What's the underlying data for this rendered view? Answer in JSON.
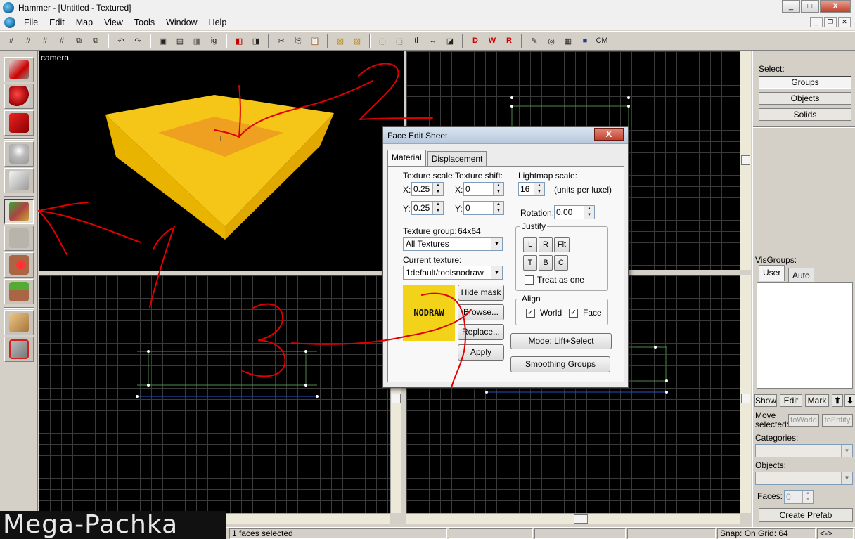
{
  "window": {
    "title": "Hammer - [Untitled - Textured]",
    "controls": [
      "_",
      "□",
      "X"
    ]
  },
  "menu": {
    "items": [
      "File",
      "Edit",
      "Map",
      "View",
      "Tools",
      "Window",
      "Help"
    ]
  },
  "toolbar": {
    "text_items": [
      "ig",
      "tl",
      "CM"
    ]
  },
  "viewports": {
    "camera_label": "camera"
  },
  "dialog": {
    "title": "Face Edit Sheet",
    "close": "X",
    "tabs": [
      "Material",
      "Displacement"
    ],
    "texture_scale_label": "Texture scale:",
    "texture_shift_label": "Texture shift:",
    "lightmap_scale_label": "Lightmap scale:",
    "x_label": "X:",
    "y_label": "Y:",
    "scale_x": "0.25",
    "scale_y": "0.25",
    "shift_x": "0",
    "shift_y": "0",
    "lightmap_scale": "16",
    "units_note": "(units per luxel)",
    "rotation_label": "Rotation:",
    "rotation": "0.00",
    "justify_label": "Justify",
    "justify_buttons": [
      "L",
      "R",
      "Fit",
      "T",
      "B",
      "C"
    ],
    "treat_as_one": "Treat as one",
    "texture_group_label": "Texture group:",
    "texture_group_size": "64x64",
    "texture_group_value": "All Textures",
    "current_texture_label": "Current texture:",
    "current_texture_value": "1default/toolsnodraw",
    "preview_text": "NODRAW",
    "hide_mask": "Hide mask",
    "browse": "Browse...",
    "replace": "Replace...",
    "apply": "Apply",
    "align_label": "Align",
    "align_world": "World",
    "align_face": "Face",
    "mode_button": "Mode: Lift+Select",
    "smoothing_button": "Smoothing Groups"
  },
  "right_panel": {
    "select_label": "Select:",
    "select_buttons": [
      "Groups",
      "Objects",
      "Solids"
    ],
    "visgroups_label": "VisGroups:",
    "visgroup_tabs": [
      "User",
      "Auto"
    ],
    "vis_buttons": [
      "Show",
      "Edit",
      "Mark"
    ],
    "move_selected_label": "Move selected:",
    "to_world": "toWorld",
    "to_entity": "toEntity",
    "categories_label": "Categories:",
    "objects_label": "Objects:",
    "faces_label": "Faces:",
    "faces_value": "0",
    "create_prefab": "Create Prefab"
  },
  "status": {
    "selection": "1 faces selected",
    "snap": "Snap: On Grid: 64",
    "arrows": "<->"
  },
  "watermark": "Mega-Pachka",
  "annotations": [
    "1",
    "2",
    "3"
  ],
  "colors": {
    "brush_top": "#f5c518",
    "brush_side": "#e8a800",
    "selected_face": "#f0a020",
    "annotation": "#e00000",
    "grid_line": "#3a3a3a"
  }
}
